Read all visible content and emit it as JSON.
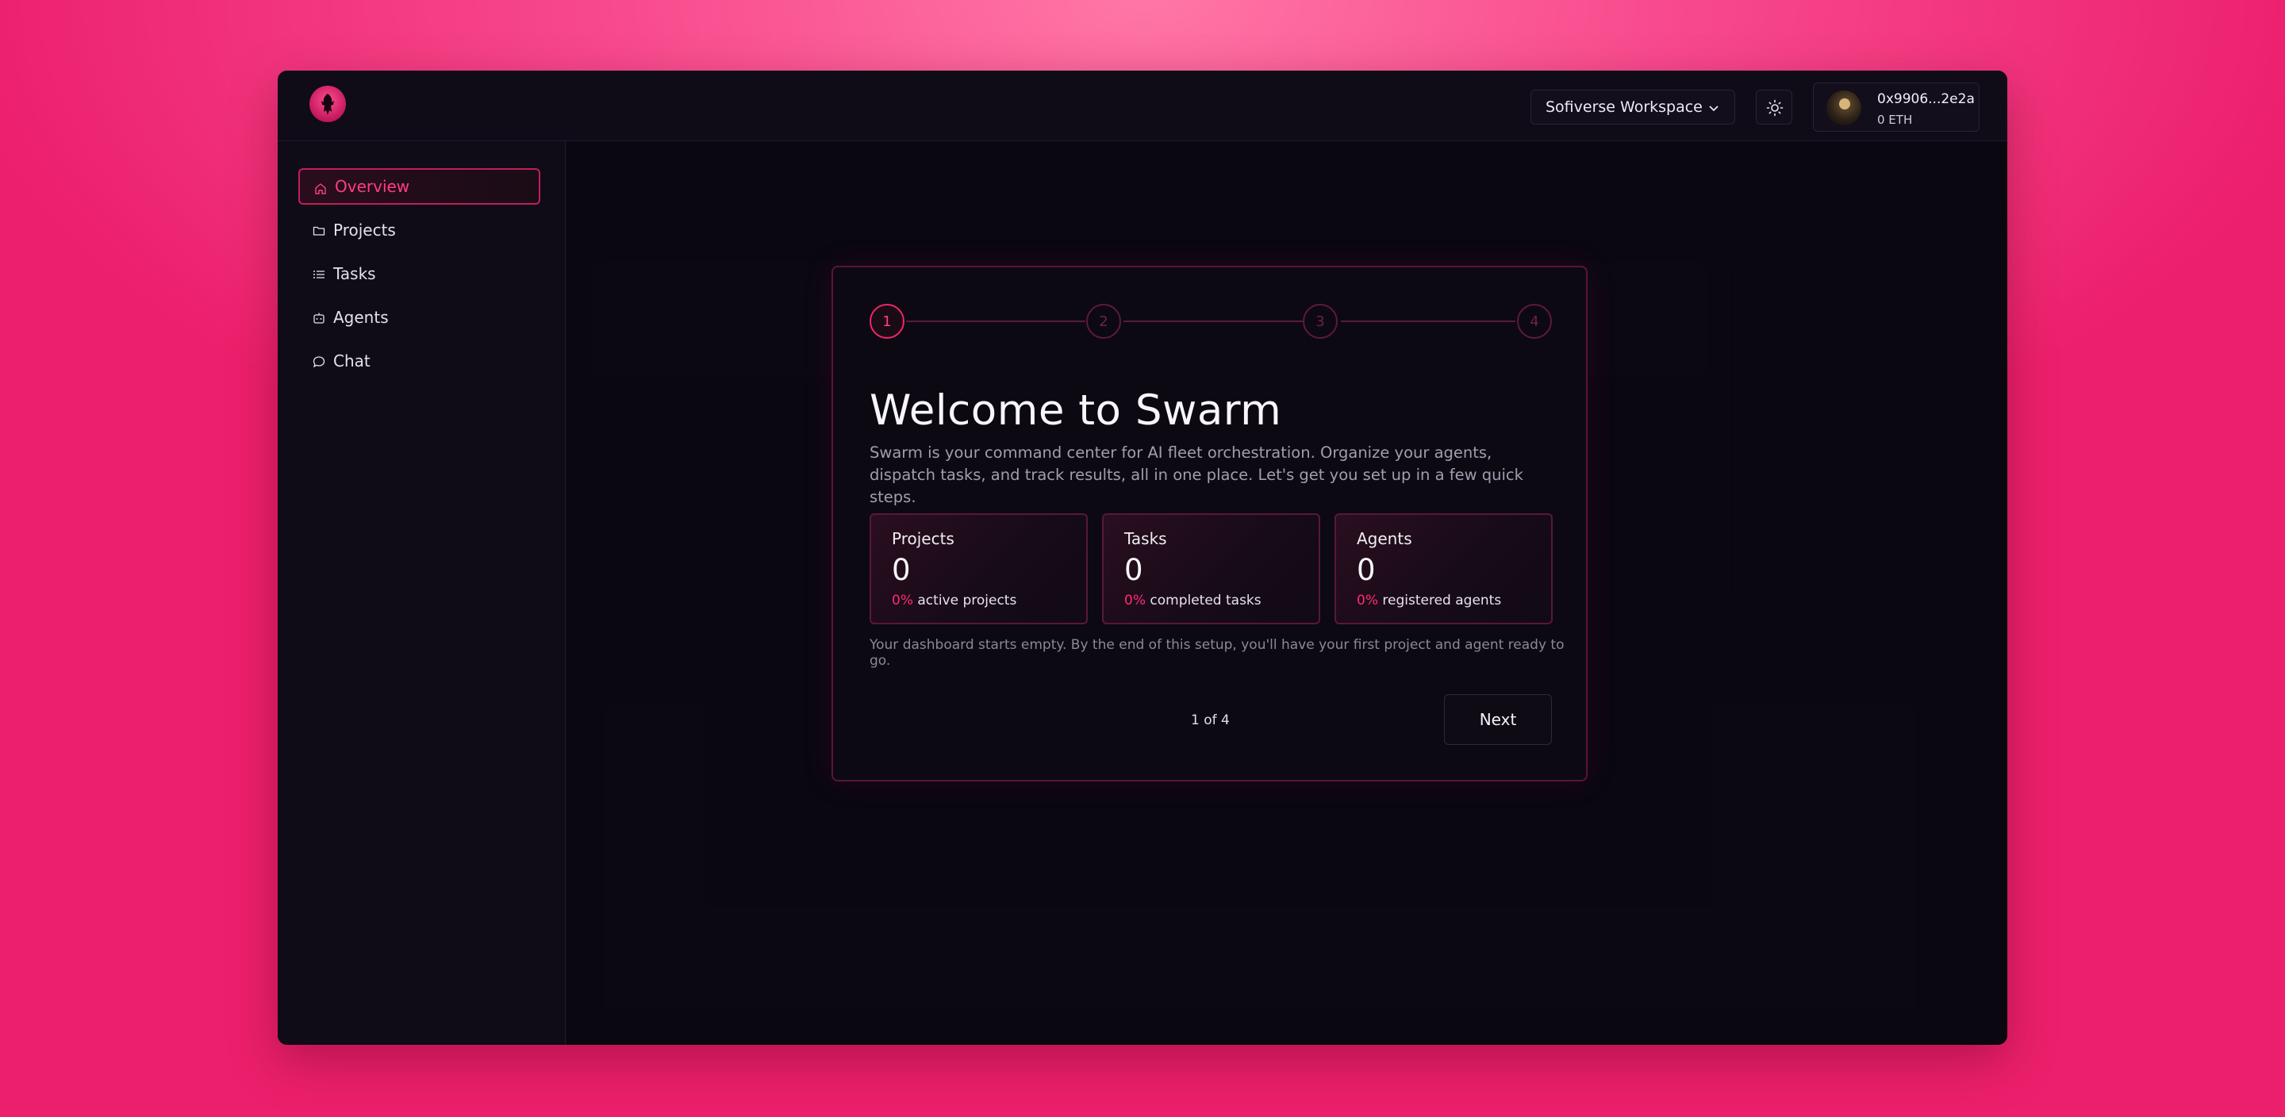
{
  "header": {
    "workspace": "Sofiverse Workspace",
    "wallet_address": "0x9906...2e2a",
    "wallet_balance": "0 ETH"
  },
  "sidebar": {
    "items": [
      {
        "label": "Overview",
        "icon": "home-icon",
        "active": true
      },
      {
        "label": "Projects",
        "icon": "folder-icon",
        "active": false
      },
      {
        "label": "Tasks",
        "icon": "list-icon",
        "active": false
      },
      {
        "label": "Agents",
        "icon": "bot-icon",
        "active": false
      },
      {
        "label": "Chat",
        "icon": "chat-icon",
        "active": false
      }
    ]
  },
  "onboarding": {
    "steps": [
      "1",
      "2",
      "3",
      "4"
    ],
    "current_step": 1,
    "title": "Welcome to Swarm",
    "intro": "Swarm is your command center for AI fleet orchestration. Organize your agents, dispatch tasks, and track results, all in one place. Let's get you set up in a few quick steps.",
    "stats": [
      {
        "label": "Projects",
        "value": "0",
        "percent": "0%",
        "caption": "active projects"
      },
      {
        "label": "Tasks",
        "value": "0",
        "percent": "0%",
        "caption": "completed tasks"
      },
      {
        "label": "Agents",
        "value": "0",
        "percent": "0%",
        "caption": "registered agents"
      }
    ],
    "note": "Your dashboard starts empty. By the end of this setup, you'll have your first project and agent ready to go.",
    "pager": "1 of 4",
    "next_label": "Next"
  },
  "colors": {
    "accent": "#ff3d86",
    "background": "#0d0a15",
    "page_gradient": "#f8498d"
  }
}
